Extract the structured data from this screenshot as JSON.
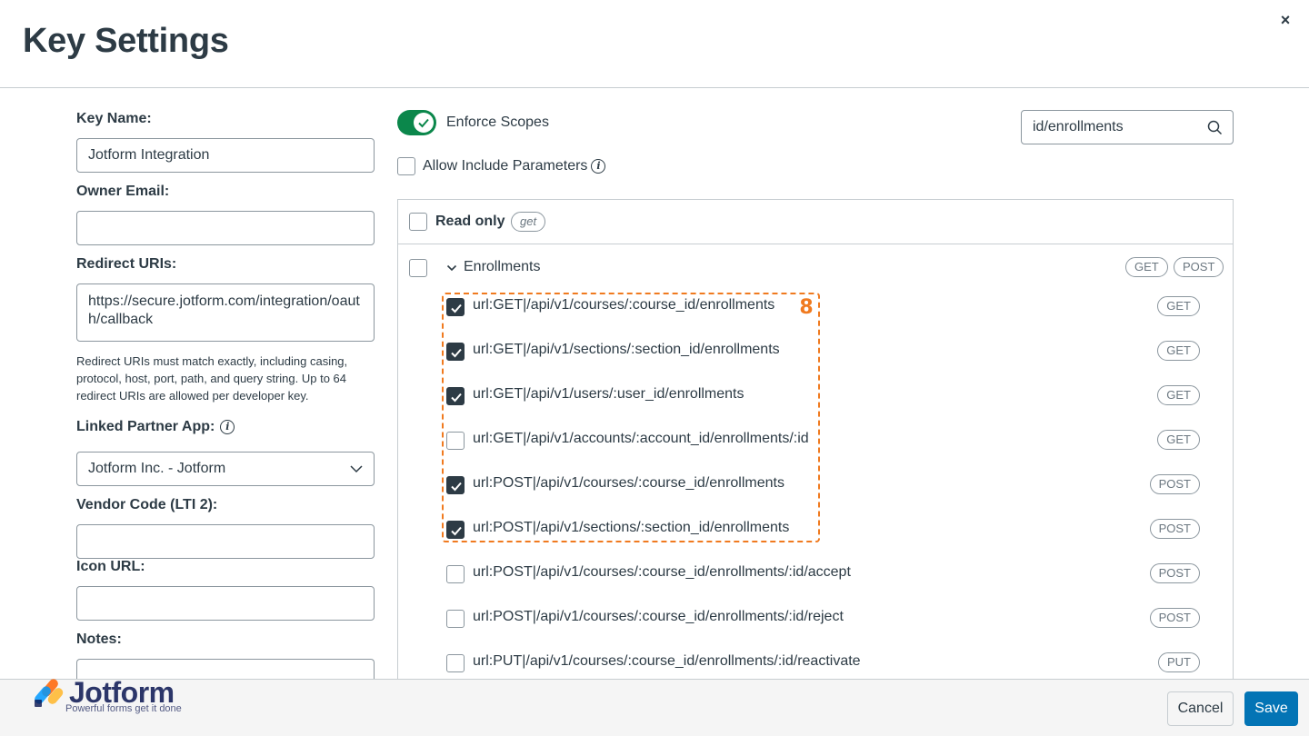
{
  "modal": {
    "title": "Key Settings",
    "close_symbol": "×"
  },
  "form": {
    "key_name_label": "Key Name:",
    "key_name_value": "Jotform Integration",
    "owner_email_label": "Owner Email:",
    "owner_email_value": "",
    "redirect_uris_label": "Redirect URIs:",
    "redirect_uris_value": "https://secure.jotform.com/integration/oauth/callback",
    "redirect_help": "Redirect URIs must match exactly, including casing, protocol, host, port, path, and query string. Up to 64 redirect URIs are allowed per developer key.",
    "linked_partner_label": "Linked Partner App:",
    "linked_partner_value": "Jotform Inc. - Jotform",
    "vendor_code_label": "Vendor Code (LTI 2):",
    "vendor_code_value": "",
    "icon_url_label": "Icon URL:",
    "icon_url_value": "",
    "notes_label": "Notes:"
  },
  "scopes": {
    "enforce_label": "Enforce Scopes",
    "enforce_on": true,
    "allow_include_label": "Allow Include Parameters",
    "allow_include_checked": false,
    "search_value": "id/enrollments",
    "read_only_label": "Read only",
    "read_only_pill": "get",
    "group_label": "Enrollments",
    "group_pills": [
      "GET",
      "POST"
    ],
    "items": [
      {
        "label": "url:GET|/api/v1/courses/:course_id/enrollments",
        "method": "GET",
        "checked": true
      },
      {
        "label": "url:GET|/api/v1/sections/:section_id/enrollments",
        "method": "GET",
        "checked": true
      },
      {
        "label": "url:GET|/api/v1/users/:user_id/enrollments",
        "method": "GET",
        "checked": true
      },
      {
        "label": "url:GET|/api/v1/accounts/:account_id/enrollments/:id",
        "method": "GET",
        "checked": false
      },
      {
        "label": "url:POST|/api/v1/courses/:course_id/enrollments",
        "method": "POST",
        "checked": true
      },
      {
        "label": "url:POST|/api/v1/sections/:section_id/enrollments",
        "method": "POST",
        "checked": true
      },
      {
        "label": "url:POST|/api/v1/courses/:course_id/enrollments/:id/accept",
        "method": "POST",
        "checked": false
      },
      {
        "label": "url:POST|/api/v1/courses/:course_id/enrollments/:id/reject",
        "method": "POST",
        "checked": false
      },
      {
        "label": "url:PUT|/api/v1/courses/:course_id/enrollments/:id/reactivate",
        "method": "PUT",
        "checked": false
      }
    ],
    "annotation_number": "8"
  },
  "footer": {
    "cancel_label": "Cancel",
    "save_label": "Save"
  },
  "logo": {
    "name": "Jotform",
    "tagline": "Powerful forms get it done"
  },
  "colors": {
    "toggle_on": "#0b874b",
    "primary_button": "#0374b5",
    "highlight": "#f07a1f",
    "text": "#2d3b45"
  }
}
